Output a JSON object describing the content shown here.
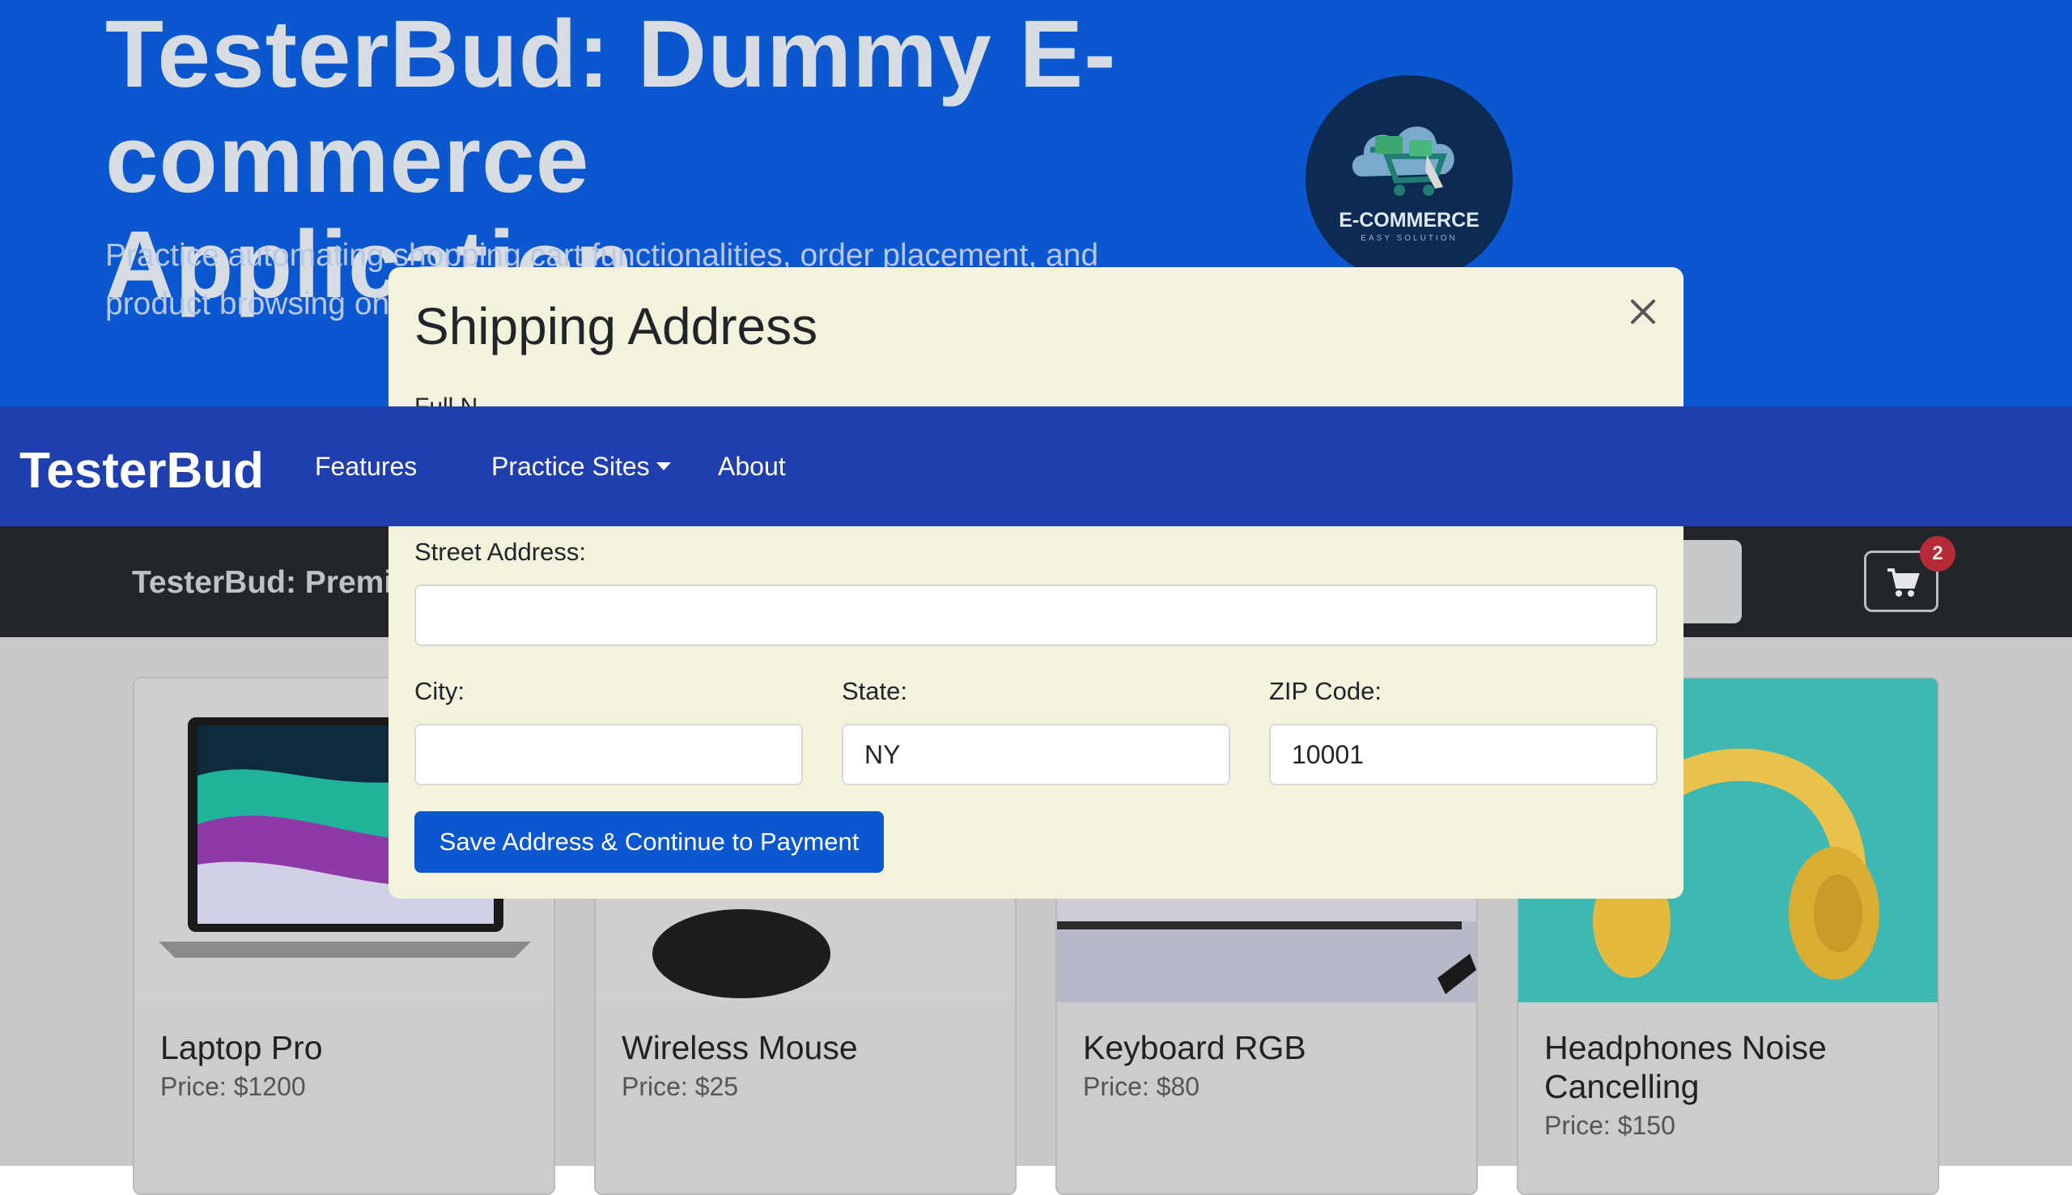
{
  "hero": {
    "title": "TesterBud: Dummy E-commerce Application",
    "subtitle": "Practice automating shopping cart functionalities, order placement, and product browsing on",
    "logo_text": "E-COMMERCE",
    "logo_tagline": "EASY SOLUTION"
  },
  "navbar": {
    "brand": "TesterBud",
    "links": [
      "Features",
      "Practice Sites",
      "About"
    ]
  },
  "subbar": {
    "title": "TesterBud: Premi",
    "cart_count": "2"
  },
  "products": [
    {
      "name": "Laptop Pro",
      "price": "Price: $1200"
    },
    {
      "name": "Wireless Mouse",
      "price": "Price: $25"
    },
    {
      "name": "Keyboard RGB",
      "price": "Price: $80"
    },
    {
      "name": "Headphones Noise Cancelling",
      "price": "Price: $150"
    }
  ],
  "modal": {
    "title": "Shipping Address",
    "partial_label": "Full N",
    "street_label": "Street Address:",
    "street_value": "",
    "city_label": "City:",
    "city_value": "",
    "state_label": "State:",
    "state_value": "NY",
    "zip_label": "ZIP Code:",
    "zip_value": "10001",
    "save_label": "Save Address & Continue to Payment"
  }
}
